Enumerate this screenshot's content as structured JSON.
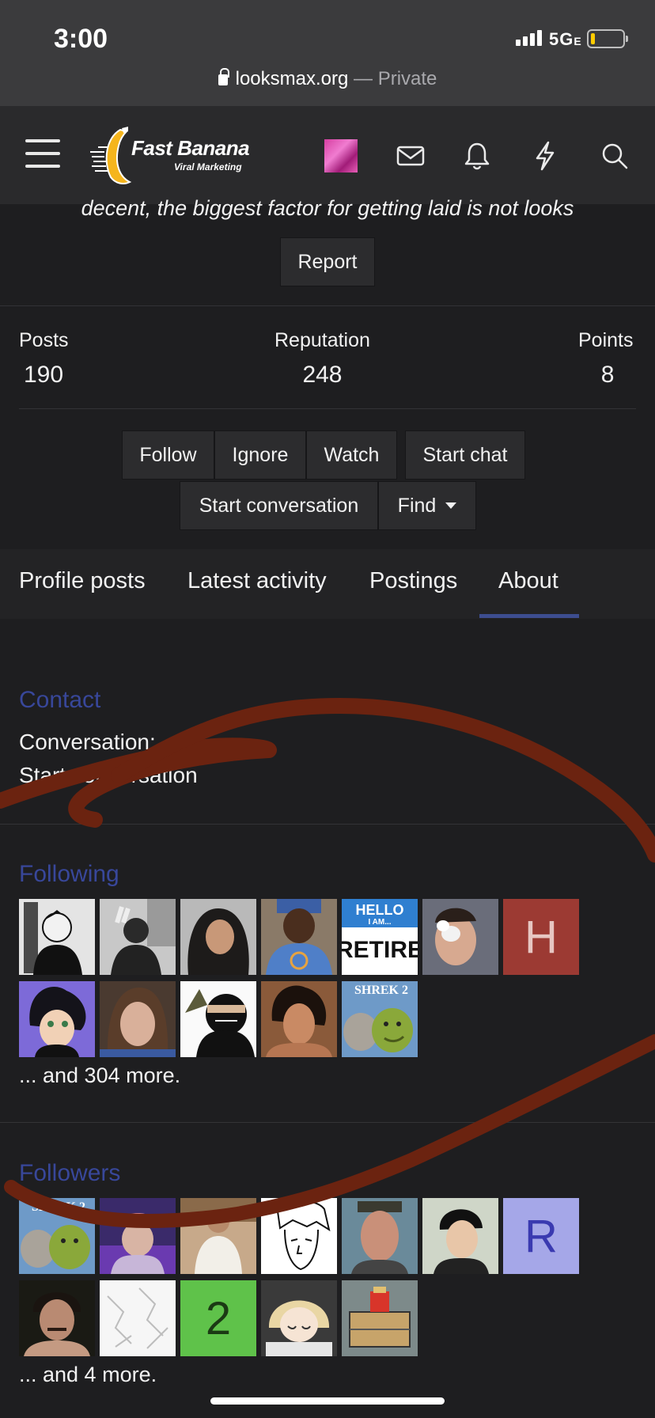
{
  "status_bar": {
    "time": "3:00",
    "network": "5G",
    "network_suffix": "E"
  },
  "url_bar": {
    "domain": "looksmax.org",
    "separator": " — ",
    "mode": "Private"
  },
  "header": {
    "logo_title": "Fast Banana",
    "logo_subtitle": "Viral Marketing",
    "icons": [
      "menu-icon",
      "mail-icon",
      "bell-icon",
      "bolt-icon",
      "search-icon"
    ]
  },
  "quote": "decent, the biggest factor for getting laid is not looks",
  "report_label": "Report",
  "stats": {
    "posts": {
      "label": "Posts",
      "value": "190"
    },
    "reputation": {
      "label": "Reputation",
      "value": "248"
    },
    "points": {
      "label": "Points",
      "value": "8"
    }
  },
  "actions": {
    "follow": "Follow",
    "ignore": "Ignore",
    "watch": "Watch",
    "start_chat": "Start chat",
    "start_conversation": "Start conversation",
    "find": "Find"
  },
  "tabs": [
    {
      "label": "Profile posts"
    },
    {
      "label": "Latest activity"
    },
    {
      "label": "Postings"
    },
    {
      "label": "About",
      "active": true
    }
  ],
  "contact": {
    "title": "Contact",
    "conversation_label": "Conversation:",
    "conversation_link": "Start conversation"
  },
  "following": {
    "title": "Following",
    "letter_avatar": "H",
    "more": "... and 304 more."
  },
  "followers": {
    "title": "Followers",
    "letter_avatar_r": "R",
    "letter_avatar_2": "2",
    "more": "... and 4 more."
  },
  "colors": {
    "accent_blue": "#38479a",
    "tab_underline": "#3d4d8f",
    "scribble": "#6b2310"
  }
}
